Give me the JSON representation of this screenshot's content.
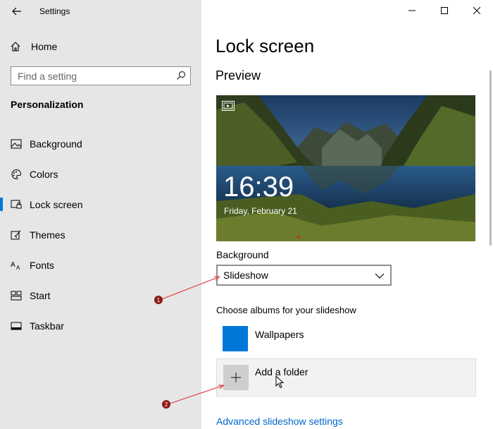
{
  "window": {
    "title": "Settings",
    "controls": [
      "minimize-icon",
      "maximize-icon",
      "close-icon"
    ]
  },
  "sidebar": {
    "home_label": "Home",
    "search_placeholder": "Find a setting",
    "section_title": "Personalization",
    "items": [
      {
        "label": "Background",
        "icon": "picture-icon",
        "active": false
      },
      {
        "label": "Colors",
        "icon": "palette-icon",
        "active": false
      },
      {
        "label": "Lock screen",
        "icon": "lock-screen-icon",
        "active": true
      },
      {
        "label": "Themes",
        "icon": "themes-icon",
        "active": false
      },
      {
        "label": "Fonts",
        "icon": "fonts-icon",
        "active": false
      },
      {
        "label": "Start",
        "icon": "start-icon",
        "active": false
      },
      {
        "label": "Taskbar",
        "icon": "taskbar-icon",
        "active": false
      }
    ]
  },
  "main": {
    "title": "Lock screen",
    "preview_title": "Preview",
    "preview": {
      "time": "16:39",
      "date": "Friday, February 21"
    },
    "background_label": "Background",
    "background_value": "Slideshow",
    "albums_label": "Choose albums for your slideshow",
    "albums": [
      {
        "name": "Wallpapers"
      }
    ],
    "add_folder_label": "Add a folder",
    "advanced_link": "Advanced slideshow settings"
  },
  "annotations": [
    {
      "number": "1"
    },
    {
      "number": "2"
    }
  ],
  "colors": {
    "accent": "#0078d7",
    "sidebar_bg": "#e6e6e6",
    "annotation": "#8b1a1a",
    "link": "#0066cc"
  }
}
